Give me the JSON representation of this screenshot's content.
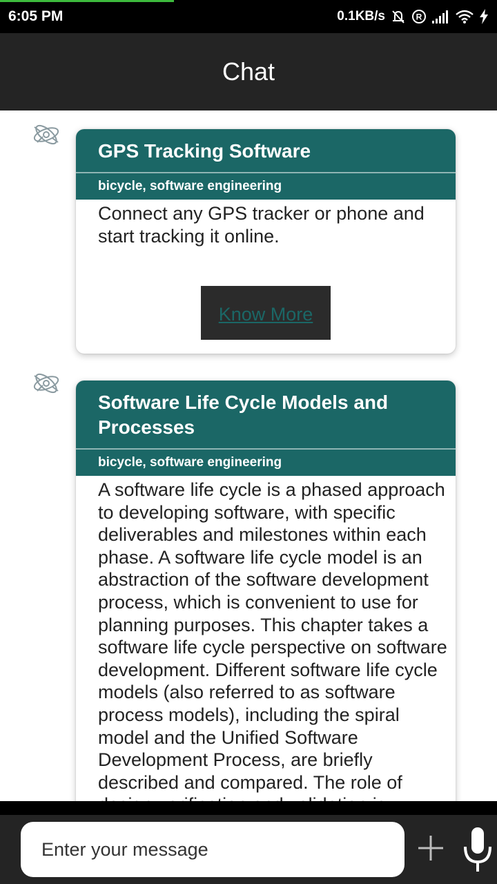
{
  "status_bar": {
    "time": "6:05 PM",
    "network_speed": "0.1KB/s",
    "icons": [
      "mute-icon",
      "registered-icon",
      "signal-icon",
      "wifi-icon",
      "charging-icon"
    ]
  },
  "header": {
    "title": "Chat"
  },
  "messages": [
    {
      "avatar": "bot-logo-icon",
      "title": "GPS Tracking Software",
      "tags": "bicycle, software engineering",
      "body": "Connect any GPS tracker or phone and start tracking it online.",
      "button_label": "Know More"
    },
    {
      "avatar": "bot-logo-icon",
      "title": "Software Life Cycle Models and Processes",
      "tags": "bicycle, software engineering",
      "body": "A software life cycle is a phased approach to developing software, with specific deliverables and milestones within each phase. A software life cycle model is an abstraction of the software development process, which is convenient to use for planning purposes. This chapter takes a software life cycle perspective on software development. Different software life cycle models (also referred to as software process models), including the spiral model and the Unified Software Development Process, are briefly described and compared. The role of design verification and validation is discussed."
    }
  ],
  "composer": {
    "placeholder": "Enter your message",
    "value": ""
  },
  "colors": {
    "accent": "#1b6766",
    "appbar": "#242424",
    "statusbar": "#000000"
  }
}
